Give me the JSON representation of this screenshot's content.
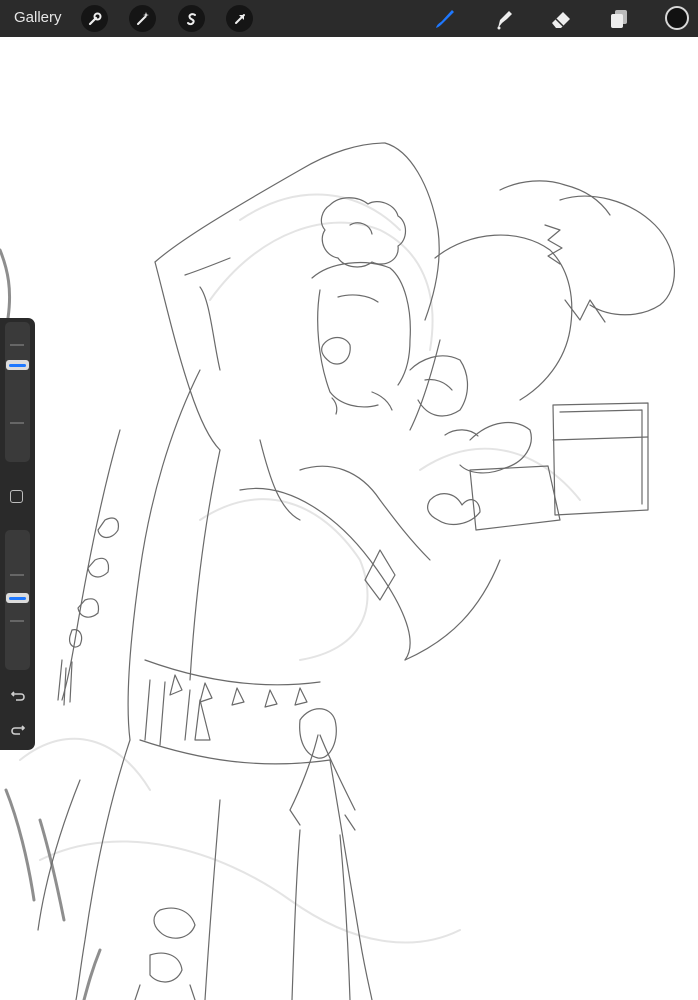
{
  "topbar": {
    "gallery_label": "Gallery",
    "left_tools": [
      "wrench-icon",
      "magic-wand-icon",
      "selection-icon",
      "transform-icon"
    ],
    "right_tools": [
      "brush-icon",
      "smudge-icon",
      "eraser-icon",
      "layers-icon"
    ],
    "active_tool": "brush-icon",
    "active_color": "#1e78ff",
    "current_color": "#111111"
  },
  "sidebar": {
    "brush_size": 0.85,
    "opacity": 0.52,
    "controls": [
      "modifier-button",
      "undo-icon",
      "redo-icon"
    ]
  }
}
